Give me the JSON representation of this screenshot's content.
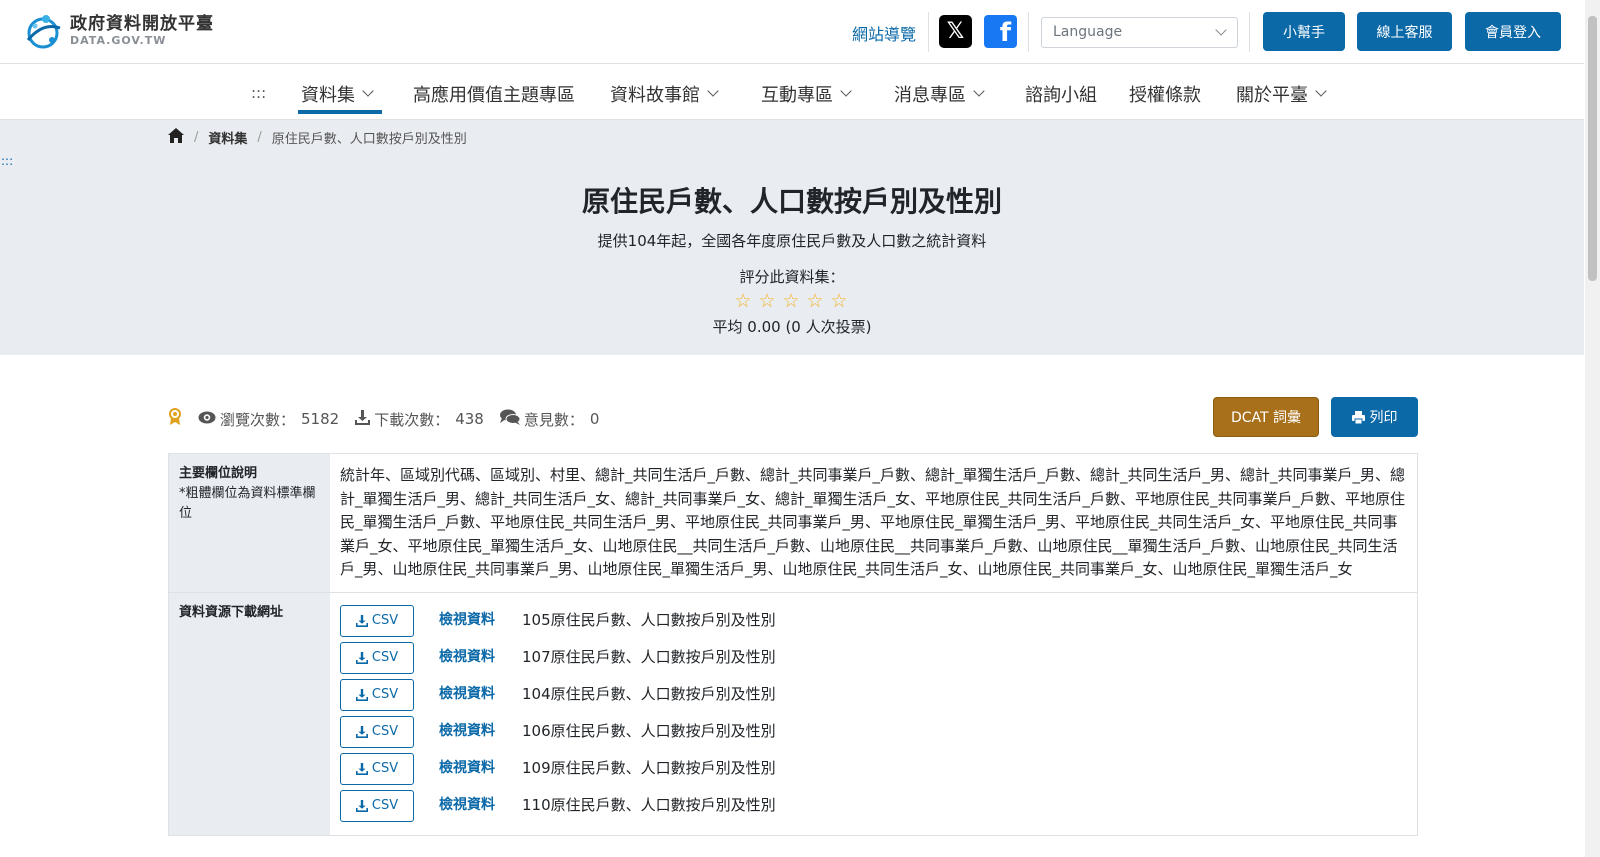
{
  "header": {
    "logo_cn": "政府資料開放平臺",
    "logo_en": "DATA.GOV.TW",
    "sitemap": "網站導覽",
    "x_glyph": "𝕏",
    "fb_glyph": "f",
    "language_placeholder": "Language",
    "helper_btn": "小幫手",
    "service_btn": "線上客服",
    "login_btn": "會員登入"
  },
  "nav": {
    "anchor": ":::",
    "items": [
      "資料集",
      "高應用價值主題專區",
      "資料故事館",
      "互動專區",
      "消息專區",
      "諮詢小組",
      "授權條款",
      "關於平臺"
    ]
  },
  "breadcrumb": {
    "dataset": "資料集",
    "current": "原住民戶數、人口數按戶別及性別"
  },
  "hero": {
    "anchor": ":::",
    "title": "原住民戶數、人口數按戶別及性別",
    "description": "提供104年起，全國各年度原住民戶數及人口數之統計資料",
    "rate_label": "評分此資料集：",
    "rating": 0,
    "rating_max": 5,
    "average": "平均 0.00 (0 人次投票)"
  },
  "stats": {
    "views_label": "瀏覽次數：",
    "views": "5182",
    "downloads_label": "下載次數：",
    "downloads": "438",
    "comments_label": "意見數：",
    "comments": "0",
    "dcat_btn": "DCAT 詞彙",
    "print_btn": "列印"
  },
  "table": {
    "fields_head": "主要欄位說明",
    "fields_note": "*粗體欄位為資料標準欄位",
    "fields_text": "統計年、區域別代碼、區域別、村里、總計_共同生活戶_戶數、總計_共同事業戶_戶數、總計_單獨生活戶_戶數、總計_共同生活戶_男、總計_共同事業戶_男、總計_單獨生活戶_男、總計_共同生活戶_女、總計_共同事業戶_女、總計_單獨生活戶_女、平地原住民_共同生活戶_戶數、平地原住民_共同事業戶_戶數、平地原住民_單獨生活戶_戶數、平地原住民_共同生活戶_男、平地原住民_共同事業戶_男、平地原住民_單獨生活戶_男、平地原住民_共同生活戶_女、平地原住民_共同事業戶_女、平地原住民_單獨生活戶_女、山地原住民__共同生活戶_戶數、山地原住民__共同事業戶_戶數、山地原住民__單獨生活戶_戶數、山地原住民_共同生活戶_男、山地原住民_共同事業戶_男、山地原住民_單獨生活戶_男、山地原住民_共同生活戶_女、山地原住民_共同事業戶_女、山地原住民_單獨生活戶_女",
    "resources_head": "資料資源下載網址",
    "csv_label": "CSV",
    "view_label": "檢視資料",
    "resources": [
      "105原住民戶數、人口數按戶別及性別",
      "107原住民戶數、人口數按戶別及性別",
      "104原住民戶數、人口數按戶別及性別",
      "106原住民戶數、人口數按戶別及性別",
      "109原住民戶數、人口數按戶別及性別",
      "110原住民戶數、人口數按戶別及性別"
    ]
  },
  "colors": {
    "brand_blue": "#0b69a8",
    "dcat_brown": "#a8701a",
    "hero_bg": "#e9ecf1",
    "star": "#f0b428"
  }
}
